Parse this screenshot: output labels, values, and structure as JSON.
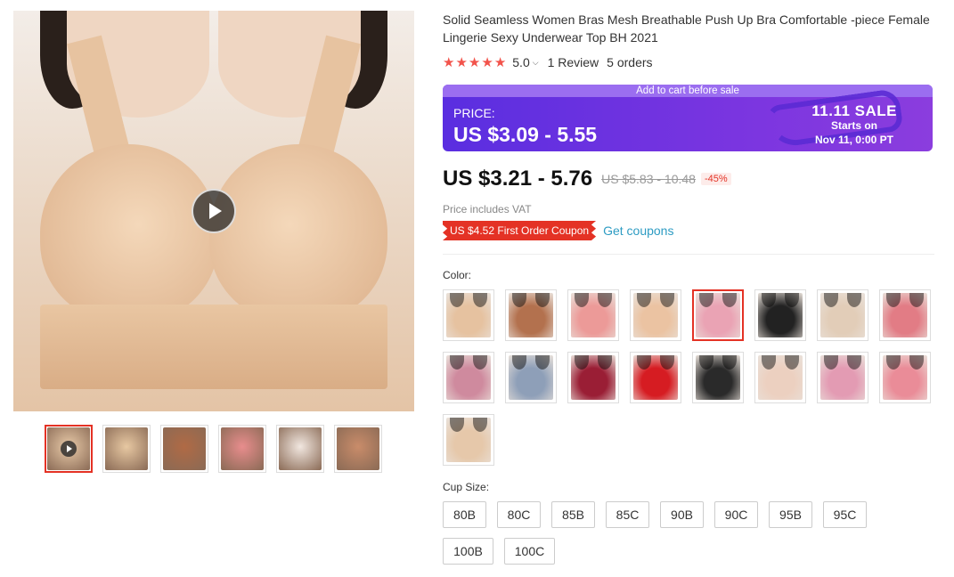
{
  "gallery": {
    "main_swatch": "#e6c2a0",
    "thumbnails": [
      {
        "color": "#e8caa8",
        "video": true,
        "active": true
      },
      {
        "color": "#e7c8a2",
        "video": false,
        "active": false
      },
      {
        "color": "#b06a45",
        "video": false,
        "active": false
      },
      {
        "color": "#e88d8d",
        "video": false,
        "active": false
      },
      {
        "color": "#f1e7e0",
        "video": false,
        "active": false
      },
      {
        "color": "#c98c6a",
        "video": false,
        "active": false
      }
    ]
  },
  "product": {
    "title": "Solid Seamless Women Bras Mesh Breathable Push Up Bra Comfortable -piece Female Lingerie Sexy Underwear Top BH 2021",
    "rating": {
      "stars": 5,
      "score": "5.0",
      "reviews": "1 Review",
      "orders": "5 orders"
    }
  },
  "sale_banner": {
    "top_text": "Add to cart before sale",
    "price_label": "PRICE:",
    "price_value": "US $3.09 - 5.55",
    "event_title": "11.11 SALE",
    "event_line1": "Starts on",
    "event_line2": "Nov 11, 0:00 PT"
  },
  "price": {
    "current": "US $3.21 - 5.76",
    "original": "US $5.83 - 10.48",
    "discount": "-45%",
    "vat_note": "Price includes VAT"
  },
  "coupon": {
    "label": "US $4.52 First Order Coupon",
    "link": "Get coupons"
  },
  "color": {
    "label": "Color:",
    "selected_index": 4,
    "options": [
      "#e6c2a0",
      "#b3714e",
      "#ec9a98",
      "#ebc3a2",
      "#eaa3b4",
      "#222222",
      "#e2cdb8",
      "#e27c85",
      "#cf8a9e",
      "#8e9fb8",
      "#9a1e35",
      "#d61c22",
      "#2a2a2a",
      "#ecd0c0",
      "#e39bb3",
      "#ea8c98",
      "#e6c8aa"
    ]
  },
  "cup_size": {
    "label": "Cup Size:",
    "options": [
      "80B",
      "80C",
      "85B",
      "85C",
      "90B",
      "90C",
      "95B",
      "95C",
      "100B",
      "100C"
    ]
  }
}
